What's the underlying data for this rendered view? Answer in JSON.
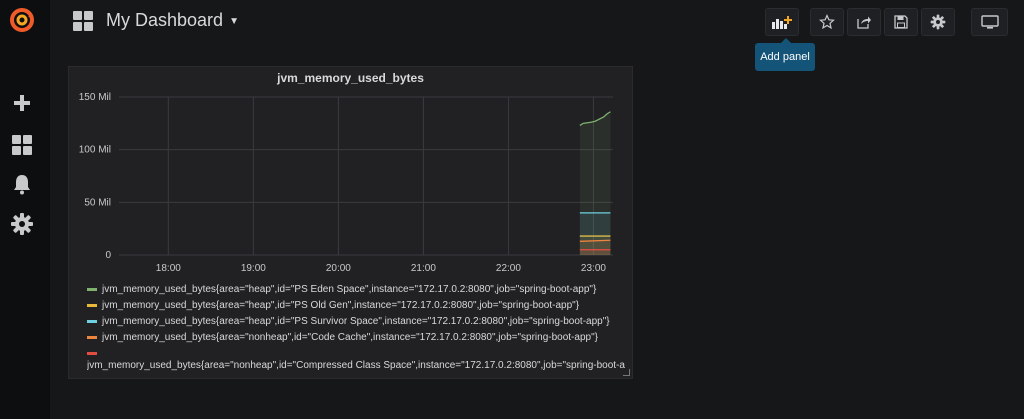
{
  "sidebar": {
    "logo": "grafana-logo-icon",
    "items": [
      {
        "icon": "plus-icon"
      },
      {
        "icon": "dashboards-icon"
      },
      {
        "icon": "bell-icon"
      },
      {
        "icon": "gear-icon"
      }
    ]
  },
  "header": {
    "title": "My Dashboard",
    "buttons": [
      "add-panel-icon",
      "star-icon",
      "share-icon",
      "save-icon",
      "gear-icon",
      "monitor-icon"
    ],
    "tooltip": "Add panel"
  },
  "colors": {
    "green": "#7eb26d",
    "yellow": "#eab839",
    "blue": "#6ed0e0",
    "orange": "#ef843c",
    "red": "#e24d42",
    "accent": "#145478"
  },
  "panel": {
    "title": "jvm_memory_used_bytes",
    "legend": [
      {
        "label": "jvm_memory_used_bytes{area=\"heap\",id=\"PS Eden Space\",instance=\"172.17.0.2:8080\",job=\"spring-boot-app\"}",
        "color": "#7eb26d"
      },
      {
        "label": "jvm_memory_used_bytes{area=\"heap\",id=\"PS Old Gen\",instance=\"172.17.0.2:8080\",job=\"spring-boot-app\"}",
        "color": "#eab839"
      },
      {
        "label": "jvm_memory_used_bytes{area=\"heap\",id=\"PS Survivor Space\",instance=\"172.17.0.2:8080\",job=\"spring-boot-app\"}",
        "color": "#6ed0e0"
      },
      {
        "label": "jvm_memory_used_bytes{area=\"nonheap\",id=\"Code Cache\",instance=\"172.17.0.2:8080\",job=\"spring-boot-app\"}",
        "color": "#ef843c"
      },
      {
        "label": "jvm_memory_used_bytes{area=\"nonheap\",id=\"Compressed Class Space\",instance=\"172.17.0.2:8080\",job=\"spring-boot-app\"}",
        "color": "#e24d42"
      }
    ]
  },
  "chart_data": {
    "type": "line",
    "title": "jvm_memory_used_bytes",
    "y_ticks": [
      "0",
      "50 Mil",
      "100 Mil",
      "150 Mil"
    ],
    "ylim": [
      0,
      150
    ],
    "x_ticks": [
      "18:00",
      "19:00",
      "20:00",
      "21:00",
      "22:00",
      "23:00"
    ],
    "xlim": [
      17.42,
      23.23
    ],
    "grid": true,
    "legend_position": "bottom",
    "series": [
      {
        "name": "jvm_memory_used_bytes{area=\"heap\",id=\"PS Eden Space\",instance=\"172.17.0.2:8080\",job=\"spring-boot-app\"}",
        "color": "#7eb26d",
        "x": [
          22.84,
          22.88,
          22.97,
          23.02,
          23.12,
          23.16,
          23.2
        ],
        "y": [
          123,
          125,
          126,
          127,
          131,
          134,
          136
        ]
      },
      {
        "name": "jvm_memory_used_bytes{area=\"heap\",id=\"PS Old Gen\",instance=\"172.17.0.2:8080\",job=\"spring-boot-app\"}",
        "color": "#eab839",
        "x": [
          22.84,
          23.2
        ],
        "y": [
          18,
          18
        ]
      },
      {
        "name": "jvm_memory_used_bytes{area=\"heap\",id=\"PS Survivor Space\",instance=\"172.17.0.2:8080\",job=\"spring-boot-app\"}",
        "color": "#6ed0e0",
        "x": [
          22.84,
          23.2
        ],
        "y": [
          40,
          40
        ]
      },
      {
        "name": "jvm_memory_used_bytes{area=\"nonheap\",id=\"Code Cache\",instance=\"172.17.0.2:8080\",job=\"spring-boot-app\"}",
        "color": "#ef843c",
        "x": [
          22.84,
          23.2
        ],
        "y": [
          13,
          14
        ]
      },
      {
        "name": "jvm_memory_used_bytes{area=\"nonheap\",id=\"Compressed Class Space\",instance=\"172.17.0.2:8080\",job=\"spring-boot-app\"}",
        "color": "#e24d42",
        "x": [
          22.84,
          23.2
        ],
        "y": [
          5,
          5
        ]
      }
    ]
  }
}
